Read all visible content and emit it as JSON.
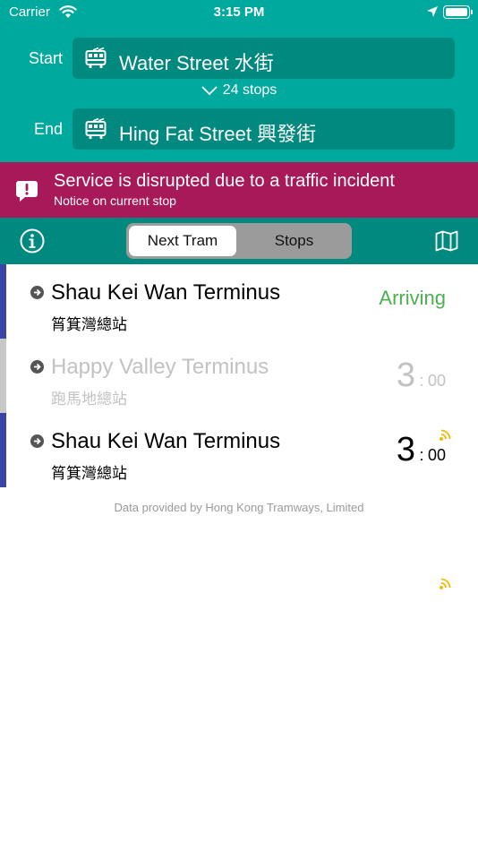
{
  "status_bar": {
    "carrier": "Carrier",
    "time": "3:15 PM"
  },
  "route": {
    "start_label": "Start",
    "start_stop": "Water Street 水街",
    "stops_count": "24  stops",
    "end_label": "End",
    "end_stop": "Hing Fat Street 興發街"
  },
  "notice": {
    "title": "Service is disrupted due to a traffic incident",
    "subtitle": "Notice on current stop"
  },
  "toolbar": {
    "tabs": [
      {
        "label": "Next Tram",
        "selected": true
      },
      {
        "label": "Stops",
        "selected": false
      }
    ]
  },
  "arrivals": [
    {
      "name": "Shau Kei Wan Terminus",
      "name_zh": "筲箕灣總站",
      "status": "Arriving",
      "accent": "#3a44a8",
      "dimmed": false
    },
    {
      "name": "Happy Valley Terminus",
      "name_zh": "跑馬地總站",
      "eta_min": "3",
      "eta_sep": ":",
      "eta_sec": "00",
      "accent": "#c8c8c8",
      "dimmed": true
    },
    {
      "name": "Shau Kei Wan Terminus",
      "name_zh": "筲箕灣總站",
      "eta_min": "3",
      "eta_sep": ":",
      "eta_sec": "00",
      "accent": "#3a44a8",
      "dimmed": false
    }
  ],
  "footer": "Data provided by Hong Kong Tramways, Limited",
  "colors": {
    "header": "#00a99d",
    "stop_box": "#00897e",
    "notice": "#a8195a",
    "arriving": "#4caf50",
    "realtime": "#f5b800"
  },
  "icons": [
    "wifi-icon",
    "location-arrow-icon",
    "battery-icon",
    "tram-icon",
    "chevron-down-icon",
    "alert-bubble-icon",
    "info-icon",
    "map-icon",
    "direction-arrow-icon",
    "realtime-signal-icon"
  ]
}
